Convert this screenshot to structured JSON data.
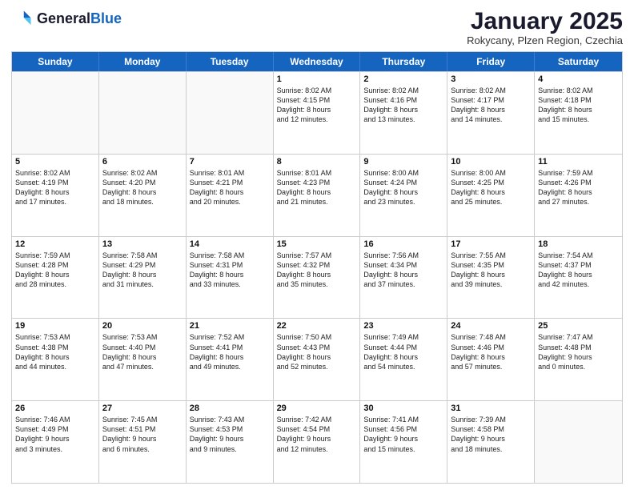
{
  "logo": {
    "line1": "General",
    "line2": "Blue"
  },
  "title": "January 2025",
  "subtitle": "Rokycany, Plzen Region, Czechia",
  "header_days": [
    "Sunday",
    "Monday",
    "Tuesday",
    "Wednesday",
    "Thursday",
    "Friday",
    "Saturday"
  ],
  "weeks": [
    [
      {
        "day": "",
        "text": "",
        "empty": true
      },
      {
        "day": "",
        "text": "",
        "empty": true
      },
      {
        "day": "",
        "text": "",
        "empty": true
      },
      {
        "day": "1",
        "text": "Sunrise: 8:02 AM\nSunset: 4:15 PM\nDaylight: 8 hours\nand 12 minutes.",
        "empty": false
      },
      {
        "day": "2",
        "text": "Sunrise: 8:02 AM\nSunset: 4:16 PM\nDaylight: 8 hours\nand 13 minutes.",
        "empty": false
      },
      {
        "day": "3",
        "text": "Sunrise: 8:02 AM\nSunset: 4:17 PM\nDaylight: 8 hours\nand 14 minutes.",
        "empty": false
      },
      {
        "day": "4",
        "text": "Sunrise: 8:02 AM\nSunset: 4:18 PM\nDaylight: 8 hours\nand 15 minutes.",
        "empty": false
      }
    ],
    [
      {
        "day": "5",
        "text": "Sunrise: 8:02 AM\nSunset: 4:19 PM\nDaylight: 8 hours\nand 17 minutes.",
        "empty": false
      },
      {
        "day": "6",
        "text": "Sunrise: 8:02 AM\nSunset: 4:20 PM\nDaylight: 8 hours\nand 18 minutes.",
        "empty": false
      },
      {
        "day": "7",
        "text": "Sunrise: 8:01 AM\nSunset: 4:21 PM\nDaylight: 8 hours\nand 20 minutes.",
        "empty": false
      },
      {
        "day": "8",
        "text": "Sunrise: 8:01 AM\nSunset: 4:23 PM\nDaylight: 8 hours\nand 21 minutes.",
        "empty": false
      },
      {
        "day": "9",
        "text": "Sunrise: 8:00 AM\nSunset: 4:24 PM\nDaylight: 8 hours\nand 23 minutes.",
        "empty": false
      },
      {
        "day": "10",
        "text": "Sunrise: 8:00 AM\nSunset: 4:25 PM\nDaylight: 8 hours\nand 25 minutes.",
        "empty": false
      },
      {
        "day": "11",
        "text": "Sunrise: 7:59 AM\nSunset: 4:26 PM\nDaylight: 8 hours\nand 27 minutes.",
        "empty": false
      }
    ],
    [
      {
        "day": "12",
        "text": "Sunrise: 7:59 AM\nSunset: 4:28 PM\nDaylight: 8 hours\nand 28 minutes.",
        "empty": false
      },
      {
        "day": "13",
        "text": "Sunrise: 7:58 AM\nSunset: 4:29 PM\nDaylight: 8 hours\nand 31 minutes.",
        "empty": false
      },
      {
        "day": "14",
        "text": "Sunrise: 7:58 AM\nSunset: 4:31 PM\nDaylight: 8 hours\nand 33 minutes.",
        "empty": false
      },
      {
        "day": "15",
        "text": "Sunrise: 7:57 AM\nSunset: 4:32 PM\nDaylight: 8 hours\nand 35 minutes.",
        "empty": false
      },
      {
        "day": "16",
        "text": "Sunrise: 7:56 AM\nSunset: 4:34 PM\nDaylight: 8 hours\nand 37 minutes.",
        "empty": false
      },
      {
        "day": "17",
        "text": "Sunrise: 7:55 AM\nSunset: 4:35 PM\nDaylight: 8 hours\nand 39 minutes.",
        "empty": false
      },
      {
        "day": "18",
        "text": "Sunrise: 7:54 AM\nSunset: 4:37 PM\nDaylight: 8 hours\nand 42 minutes.",
        "empty": false
      }
    ],
    [
      {
        "day": "19",
        "text": "Sunrise: 7:53 AM\nSunset: 4:38 PM\nDaylight: 8 hours\nand 44 minutes.",
        "empty": false
      },
      {
        "day": "20",
        "text": "Sunrise: 7:53 AM\nSunset: 4:40 PM\nDaylight: 8 hours\nand 47 minutes.",
        "empty": false
      },
      {
        "day": "21",
        "text": "Sunrise: 7:52 AM\nSunset: 4:41 PM\nDaylight: 8 hours\nand 49 minutes.",
        "empty": false
      },
      {
        "day": "22",
        "text": "Sunrise: 7:50 AM\nSunset: 4:43 PM\nDaylight: 8 hours\nand 52 minutes.",
        "empty": false
      },
      {
        "day": "23",
        "text": "Sunrise: 7:49 AM\nSunset: 4:44 PM\nDaylight: 8 hours\nand 54 minutes.",
        "empty": false
      },
      {
        "day": "24",
        "text": "Sunrise: 7:48 AM\nSunset: 4:46 PM\nDaylight: 8 hours\nand 57 minutes.",
        "empty": false
      },
      {
        "day": "25",
        "text": "Sunrise: 7:47 AM\nSunset: 4:48 PM\nDaylight: 9 hours\nand 0 minutes.",
        "empty": false
      }
    ],
    [
      {
        "day": "26",
        "text": "Sunrise: 7:46 AM\nSunset: 4:49 PM\nDaylight: 9 hours\nand 3 minutes.",
        "empty": false
      },
      {
        "day": "27",
        "text": "Sunrise: 7:45 AM\nSunset: 4:51 PM\nDaylight: 9 hours\nand 6 minutes.",
        "empty": false
      },
      {
        "day": "28",
        "text": "Sunrise: 7:43 AM\nSunset: 4:53 PM\nDaylight: 9 hours\nand 9 minutes.",
        "empty": false
      },
      {
        "day": "29",
        "text": "Sunrise: 7:42 AM\nSunset: 4:54 PM\nDaylight: 9 hours\nand 12 minutes.",
        "empty": false
      },
      {
        "day": "30",
        "text": "Sunrise: 7:41 AM\nSunset: 4:56 PM\nDaylight: 9 hours\nand 15 minutes.",
        "empty": false
      },
      {
        "day": "31",
        "text": "Sunrise: 7:39 AM\nSunset: 4:58 PM\nDaylight: 9 hours\nand 18 minutes.",
        "empty": false
      },
      {
        "day": "",
        "text": "",
        "empty": true
      }
    ]
  ]
}
